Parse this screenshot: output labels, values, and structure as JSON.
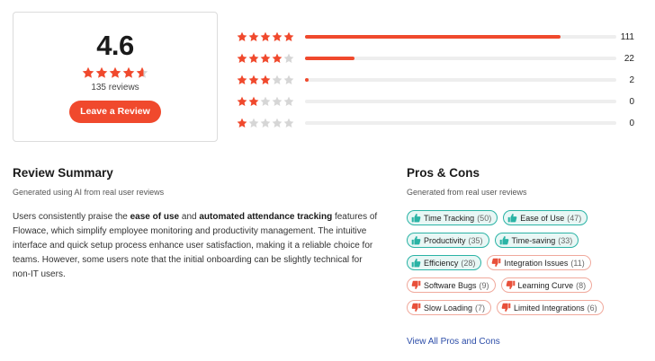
{
  "rating": {
    "average": "4.6",
    "stars_value": 4.6,
    "review_count": "135 reviews",
    "button_label": "Leave a Review"
  },
  "distribution": [
    {
      "stars": 5,
      "count": "111",
      "fraction": 0.82
    },
    {
      "stars": 4,
      "count": "22",
      "fraction": 0.16
    },
    {
      "stars": 3,
      "count": "2",
      "fraction": 0.0
    },
    {
      "stars": 2,
      "count": "0",
      "fraction": 0
    },
    {
      "stars": 1,
      "count": "0",
      "fraction": 0
    }
  ],
  "summary": {
    "title": "Review Summary",
    "subtitle": "Generated using AI from real user reviews",
    "text_parts": [
      {
        "t": "Users consistently praise the ",
        "b": false
      },
      {
        "t": "ease of use",
        "b": true
      },
      {
        "t": " and ",
        "b": false
      },
      {
        "t": "automated attendance tracking",
        "b": true
      },
      {
        "t": " features of Flowace, which simplify employee monitoring and productivity management. The intuitive interface and quick setup process enhance user satisfaction, making it a reliable choice for teams. However, some users note that the initial onboarding can be slightly technical for non-IT users.",
        "b": false
      }
    ]
  },
  "pros_cons": {
    "title": "Pros & Cons",
    "subtitle": "Generated from real user reviews",
    "chips": [
      {
        "label": "Time Tracking",
        "count": "(50)",
        "kind": "pro"
      },
      {
        "label": "Ease of Use",
        "count": "(47)",
        "kind": "pro"
      },
      {
        "label": "Productivity",
        "count": "(35)",
        "kind": "pro"
      },
      {
        "label": "Time-saving",
        "count": "(33)",
        "kind": "pro"
      },
      {
        "label": "Efficiency",
        "count": "(28)",
        "kind": "pro"
      },
      {
        "label": "Integration Issues",
        "count": "(11)",
        "kind": "con"
      },
      {
        "label": "Software Bugs",
        "count": "(9)",
        "kind": "con"
      },
      {
        "label": "Learning Curve",
        "count": "(8)",
        "kind": "con"
      },
      {
        "label": "Slow Loading",
        "count": "(7)",
        "kind": "con"
      },
      {
        "label": "Limited Integrations",
        "count": "(6)",
        "kind": "con"
      }
    ],
    "link": "View All Pros and Cons"
  },
  "colors": {
    "accent": "#f0492d",
    "star_empty": "#d6d6d6",
    "pro": "#2ab3a5",
    "con": "#e8503a",
    "link": "#2c4da8"
  }
}
